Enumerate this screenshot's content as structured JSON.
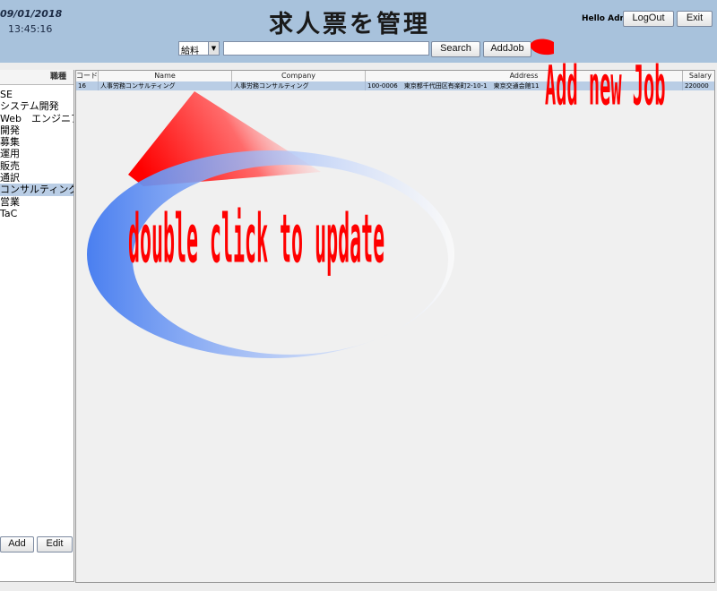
{
  "header": {
    "date": "09/01/2018",
    "time": "13:45:16",
    "title": "求人票を管理",
    "greeting": "Hello Admin",
    "logout_label": "LogOut",
    "exit_label": "Exit"
  },
  "search": {
    "field_selected": "給料",
    "value": "",
    "search_label": "Search",
    "addjob_label": "AddJob"
  },
  "sidebar": {
    "header": "職種",
    "items": [
      {
        "label": "SE"
      },
      {
        "label": "システム開発"
      },
      {
        "label": "Web　エンジニア"
      },
      {
        "label": "開発"
      },
      {
        "label": "募集"
      },
      {
        "label": "運用"
      },
      {
        "label": "販売"
      },
      {
        "label": "通訳"
      },
      {
        "label": "コンサルティング"
      },
      {
        "label": "営業"
      },
      {
        "label": "TaC"
      }
    ],
    "selected_index": 8,
    "add_label": "Add",
    "edit_label": "Edit"
  },
  "table": {
    "columns": [
      "コード",
      "Name",
      "Company",
      "Address",
      "Salary"
    ],
    "rows": [
      [
        "16",
        "人事労務コンサルティング",
        "人事労務コンサルティング",
        "100-0006　東京都千代田区有楽町2-10-1　東京交通会館11",
        "220000"
      ]
    ]
  },
  "annotations": {
    "add_new_job": "Add new Job",
    "double_click": "double click to update"
  },
  "colors": {
    "header_bg": "#a8c2dc",
    "selected_bg": "#b9cde5",
    "annotation_red": "#ff0000",
    "annotation_blue": "#4a7ff0"
  }
}
